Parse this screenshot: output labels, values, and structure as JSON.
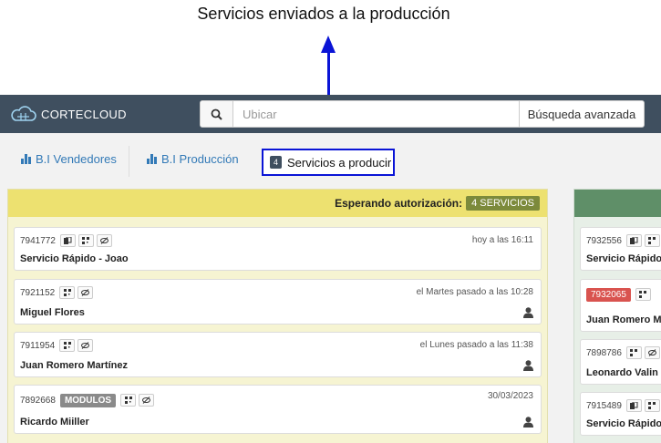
{
  "annotation": {
    "text": "Servicios enviados a la producción"
  },
  "navbar": {
    "logo_text": "CORTECLOUD",
    "search_placeholder": "Ubicar",
    "advanced_search_label": "Búsqueda avanzada"
  },
  "tabs": {
    "vendedores": "B.I Vendedores",
    "produccion": "B.I Producción",
    "servicios_count": "4",
    "servicios_label": "Servicios a producir"
  },
  "columns": {
    "waiting": {
      "title": "Esperando autorización:",
      "badge": "4 SERVICIOS",
      "cards": [
        {
          "id": "7941772",
          "time": "hoy a las 16:11",
          "name": "Servicio Rápido - Joao"
        },
        {
          "id": "7921152",
          "time": "el Martes pasado a las 10:28",
          "name": "Miguel Flores"
        },
        {
          "id": "7911954",
          "time": "el Lunes pasado a las 11:38",
          "name": "Juan Romero Martínez"
        },
        {
          "id": "7892668",
          "badge": "MODULOS",
          "time": "30/03/2023",
          "name": "Ricardo Miiller"
        }
      ]
    },
    "second": {
      "cards": [
        {
          "id": "7932556",
          "name": "Servicio Rápido"
        },
        {
          "id": "7932065",
          "name": "Juan Romero M"
        },
        {
          "id": "7898786",
          "name": "Leonardo Valin"
        },
        {
          "id": "7915489",
          "name": "Servicio Rápido"
        }
      ]
    }
  },
  "colors": {
    "navbar": "#3f4f5f",
    "annotation_blue": "#0a14d6",
    "yellow_header": "#ede170",
    "green_header": "#5f8f68",
    "link": "#337ab7",
    "red_badge": "#d9534f"
  },
  "icons": [
    "cloud-icon",
    "search-icon",
    "bar-chart-icon",
    "copy-icon",
    "qr-icon",
    "eye-slash-icon",
    "user-icon"
  ]
}
